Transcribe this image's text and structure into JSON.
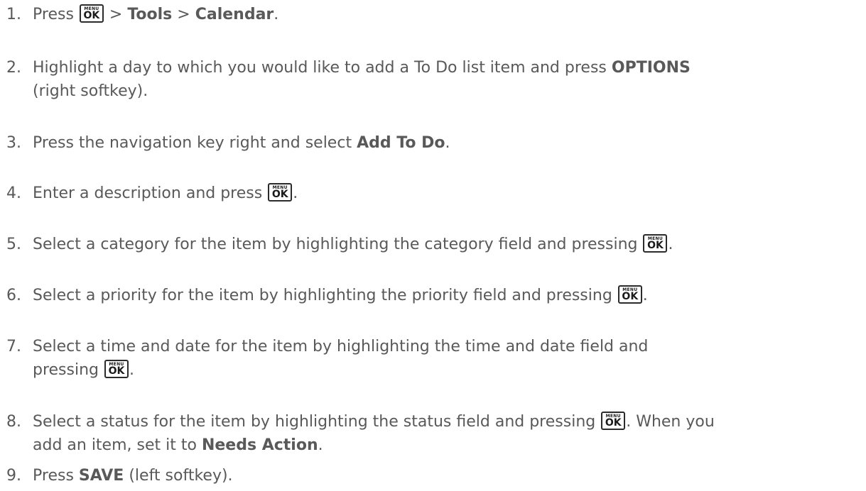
{
  "ok_key": {
    "menu_label": "MENU",
    "ok_label": "OK",
    "icon": "menu-ok-key-icon"
  },
  "steps": [
    {
      "number": "1.",
      "parts": [
        "Press ",
        "{key}",
        " > ",
        "**Tools",
        " > ",
        "**Calendar",
        "."
      ]
    },
    {
      "number": "2.",
      "parts": [
        "Highlight a day to which you would like to add a To Do list item and press ",
        "**OPTIONS",
        "\n(right softkey)."
      ]
    },
    {
      "number": "3.",
      "parts": [
        "Press the navigation key right and select ",
        "**Add To Do",
        "."
      ]
    },
    {
      "number": "4.",
      "parts": [
        "Enter a description and press ",
        "{key}",
        "."
      ]
    },
    {
      "number": "5.",
      "parts": [
        "Select a category for the item by highlighting the category field and pressing ",
        "{key}",
        "."
      ]
    },
    {
      "number": "6.",
      "parts": [
        "Select a priority for the item by highlighting the priority field and pressing ",
        "{key}",
        "."
      ]
    },
    {
      "number": "7.",
      "parts": [
        "Select a time and date for the item by highlighting the time and date field and\npressing ",
        "{key}",
        "."
      ]
    },
    {
      "number": "8.",
      "parts": [
        "Select a status for the item by highlighting the status field and pressing ",
        "{key}",
        ". When you\nadd an item, set it to ",
        "**Needs Action",
        "."
      ]
    },
    {
      "number": "9.",
      "parts": [
        "Press ",
        "**SAVE",
        " (left softkey)."
      ]
    }
  ]
}
